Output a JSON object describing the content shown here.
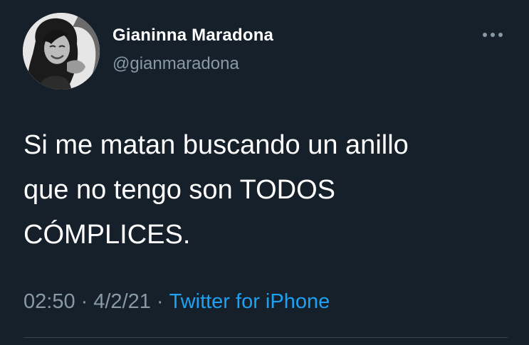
{
  "tweet": {
    "author": {
      "display_name": "Gianinna Maradona",
      "handle": "@gianmaradona"
    },
    "more_icon": "more-horizontal-icon",
    "text_lines": [
      "Si me matan buscando un anillo",
      "que no tengo son TODOS",
      "CÓMPLICES."
    ],
    "meta": {
      "time": "02:50",
      "separator": "·",
      "date": "4/2/21",
      "source": "Twitter for iPhone"
    }
  },
  "colors": {
    "background": "#15202b",
    "text": "#ffffff",
    "secondary_text": "#8899a6",
    "link": "#1da1f2",
    "divider": "#38444d"
  }
}
